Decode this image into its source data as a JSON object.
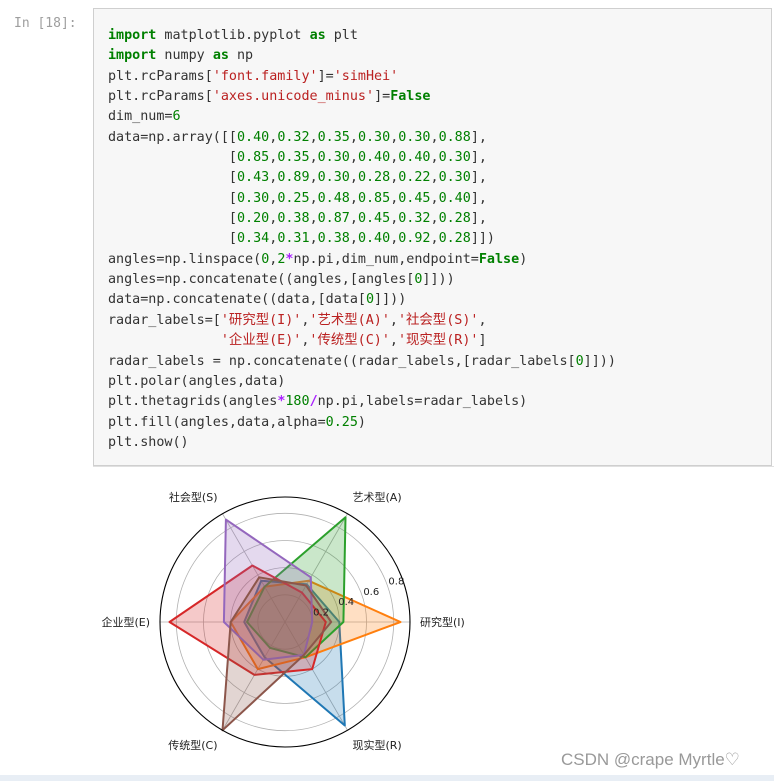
{
  "cell": {
    "prompt": "In [18]:",
    "code_lines": [
      [
        {
          "t": "import",
          "c": "kw"
        },
        {
          "t": " matplotlib.pyplot "
        },
        {
          "t": "as",
          "c": "kw"
        },
        {
          "t": " plt"
        }
      ],
      [
        {
          "t": "import",
          "c": "kw"
        },
        {
          "t": " numpy "
        },
        {
          "t": "as",
          "c": "kw"
        },
        {
          "t": " np"
        }
      ],
      [
        {
          "t": "plt.rcParams["
        },
        {
          "t": "'font.family'",
          "c": "str"
        },
        {
          "t": "]="
        },
        {
          "t": "'simHei'",
          "c": "str"
        }
      ],
      [
        {
          "t": "plt.rcParams["
        },
        {
          "t": "'axes.unicode_minus'",
          "c": "str"
        },
        {
          "t": "]="
        },
        {
          "t": "False",
          "c": "kw"
        }
      ],
      [
        {
          "t": "dim_num="
        },
        {
          "t": "6",
          "c": "num"
        }
      ],
      [
        {
          "t": "data=np.array([["
        },
        {
          "t": "0.40",
          "c": "num"
        },
        {
          "t": ","
        },
        {
          "t": "0.32",
          "c": "num"
        },
        {
          "t": ","
        },
        {
          "t": "0.35",
          "c": "num"
        },
        {
          "t": ","
        },
        {
          "t": "0.30",
          "c": "num"
        },
        {
          "t": ","
        },
        {
          "t": "0.30",
          "c": "num"
        },
        {
          "t": ","
        },
        {
          "t": "0.88",
          "c": "num"
        },
        {
          "t": "],"
        }
      ],
      [
        {
          "t": "               ["
        },
        {
          "t": "0.85",
          "c": "num"
        },
        {
          "t": ","
        },
        {
          "t": "0.35",
          "c": "num"
        },
        {
          "t": ","
        },
        {
          "t": "0.30",
          "c": "num"
        },
        {
          "t": ","
        },
        {
          "t": "0.40",
          "c": "num"
        },
        {
          "t": ","
        },
        {
          "t": "0.40",
          "c": "num"
        },
        {
          "t": ","
        },
        {
          "t": "0.30",
          "c": "num"
        },
        {
          "t": "],"
        }
      ],
      [
        {
          "t": "               ["
        },
        {
          "t": "0.43",
          "c": "num"
        },
        {
          "t": ","
        },
        {
          "t": "0.89",
          "c": "num"
        },
        {
          "t": ","
        },
        {
          "t": "0.30",
          "c": "num"
        },
        {
          "t": ","
        },
        {
          "t": "0.28",
          "c": "num"
        },
        {
          "t": ","
        },
        {
          "t": "0.22",
          "c": "num"
        },
        {
          "t": ","
        },
        {
          "t": "0.30",
          "c": "num"
        },
        {
          "t": "],"
        }
      ],
      [
        {
          "t": "               ["
        },
        {
          "t": "0.30",
          "c": "num"
        },
        {
          "t": ","
        },
        {
          "t": "0.25",
          "c": "num"
        },
        {
          "t": ","
        },
        {
          "t": "0.48",
          "c": "num"
        },
        {
          "t": ","
        },
        {
          "t": "0.85",
          "c": "num"
        },
        {
          "t": ","
        },
        {
          "t": "0.45",
          "c": "num"
        },
        {
          "t": ","
        },
        {
          "t": "0.40",
          "c": "num"
        },
        {
          "t": "],"
        }
      ],
      [
        {
          "t": "               ["
        },
        {
          "t": "0.20",
          "c": "num"
        },
        {
          "t": ","
        },
        {
          "t": "0.38",
          "c": "num"
        },
        {
          "t": ","
        },
        {
          "t": "0.87",
          "c": "num"
        },
        {
          "t": ","
        },
        {
          "t": "0.45",
          "c": "num"
        },
        {
          "t": ","
        },
        {
          "t": "0.32",
          "c": "num"
        },
        {
          "t": ","
        },
        {
          "t": "0.28",
          "c": "num"
        },
        {
          "t": "],"
        }
      ],
      [
        {
          "t": "               ["
        },
        {
          "t": "0.34",
          "c": "num"
        },
        {
          "t": ","
        },
        {
          "t": "0.31",
          "c": "num"
        },
        {
          "t": ","
        },
        {
          "t": "0.38",
          "c": "num"
        },
        {
          "t": ","
        },
        {
          "t": "0.40",
          "c": "num"
        },
        {
          "t": ","
        },
        {
          "t": "0.92",
          "c": "num"
        },
        {
          "t": ","
        },
        {
          "t": "0.28",
          "c": "num"
        },
        {
          "t": "]])"
        }
      ],
      [
        {
          "t": "angles=np.linspace("
        },
        {
          "t": "0",
          "c": "num"
        },
        {
          "t": ","
        },
        {
          "t": "2",
          "c": "num"
        },
        {
          "t": "*",
          "c": "op"
        },
        {
          "t": "np.pi,dim_num,endpoint="
        },
        {
          "t": "False",
          "c": "kw"
        },
        {
          "t": ")"
        }
      ],
      [
        {
          "t": "angles=np.concatenate((angles,[angles["
        },
        {
          "t": "0",
          "c": "num"
        },
        {
          "t": "]]))"
        }
      ],
      [
        {
          "t": "data=np.concatenate((data,[data["
        },
        {
          "t": "0",
          "c": "num"
        },
        {
          "t": "]]))"
        }
      ],
      [
        {
          "t": "radar_labels=["
        },
        {
          "t": "'研究型(I)'",
          "c": "str"
        },
        {
          "t": ","
        },
        {
          "t": "'艺术型(A)'",
          "c": "str"
        },
        {
          "t": ","
        },
        {
          "t": "'社会型(S)'",
          "c": "str"
        },
        {
          "t": ","
        }
      ],
      [
        {
          "t": "              "
        },
        {
          "t": "'企业型(E)'",
          "c": "str"
        },
        {
          "t": ","
        },
        {
          "t": "'传统型(C)'",
          "c": "str"
        },
        {
          "t": ","
        },
        {
          "t": "'现实型(R)'",
          "c": "str"
        },
        {
          "t": "]"
        }
      ],
      [
        {
          "t": "radar_labels = np.concatenate((radar_labels,[radar_labels["
        },
        {
          "t": "0",
          "c": "num"
        },
        {
          "t": "]]))"
        }
      ],
      [
        {
          "t": "plt.polar(angles,data)"
        }
      ],
      [
        {
          "t": "plt.thetagrids(angles"
        },
        {
          "t": "*",
          "c": "op"
        },
        {
          "t": "180",
          "c": "num"
        },
        {
          "t": "/",
          "c": "op"
        },
        {
          "t": "np.pi,labels=radar_labels)"
        }
      ],
      [
        {
          "t": "plt.fill(angles,data,alpha="
        },
        {
          "t": "0.25",
          "c": "num"
        },
        {
          "t": ")"
        }
      ],
      [
        {
          "t": "plt.show()"
        }
      ]
    ]
  },
  "chart_data": {
    "type": "radar",
    "categories": [
      "研究型(I)",
      "艺术型(A)",
      "社会型(S)",
      "企业型(E)",
      "传统型(C)",
      "现实型(R)"
    ],
    "rlim": [
      0,
      0.92
    ],
    "r_ticks": [
      "0.2",
      "0.4",
      "0.6",
      "0.8"
    ],
    "grid": true,
    "fill_alpha": 0.25,
    "series": [
      {
        "values": [
          0.4,
          0.32,
          0.35,
          0.3,
          0.3,
          0.88
        ],
        "color": "#1f77b4"
      },
      {
        "values": [
          0.85,
          0.35,
          0.3,
          0.4,
          0.4,
          0.3
        ],
        "color": "#ff7f0e"
      },
      {
        "values": [
          0.43,
          0.89,
          0.3,
          0.28,
          0.22,
          0.3
        ],
        "color": "#2ca02c"
      },
      {
        "values": [
          0.3,
          0.25,
          0.48,
          0.85,
          0.45,
          0.4
        ],
        "color": "#d62728"
      },
      {
        "values": [
          0.2,
          0.38,
          0.87,
          0.45,
          0.32,
          0.28
        ],
        "color": "#9467bd"
      },
      {
        "values": [
          0.34,
          0.31,
          0.38,
          0.4,
          0.92,
          0.28
        ],
        "color": "#8c564b"
      }
    ]
  },
  "watermark": "CSDN @crape Myrtle♡"
}
